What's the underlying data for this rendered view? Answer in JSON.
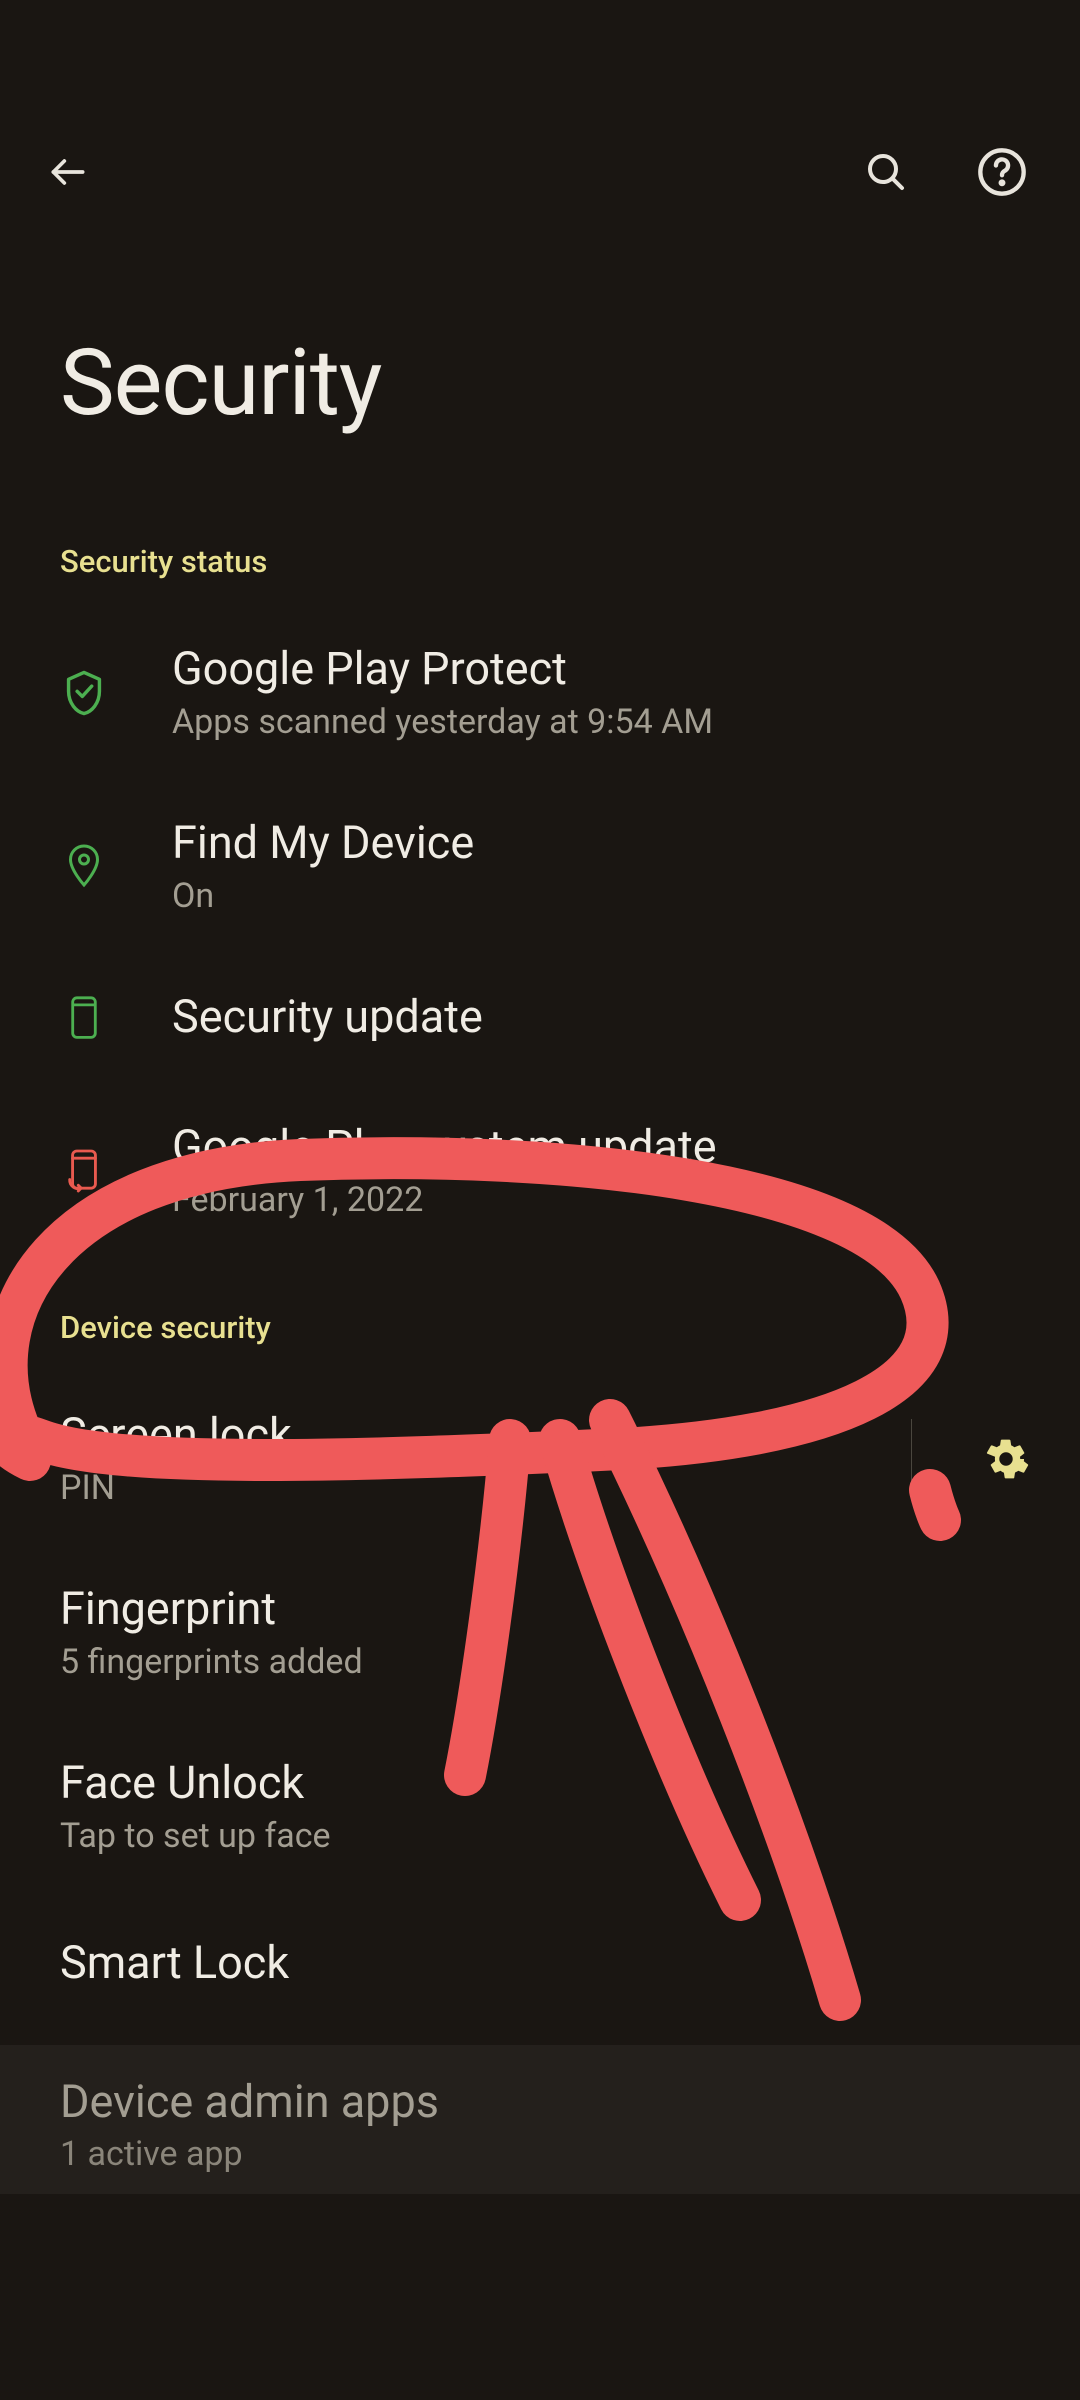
{
  "header": {
    "title": "Security"
  },
  "sections": {
    "status_label": "Security status",
    "device_label": "Device security"
  },
  "status": {
    "play_protect": {
      "title": "Google Play Protect",
      "sub": "Apps scanned yesterday at 9:54 AM"
    },
    "find_device": {
      "title": "Find My Device",
      "sub": "On"
    },
    "sec_update": {
      "title": "Security update"
    },
    "play_system": {
      "title": "Google Play system update",
      "sub": "February 1, 2022"
    }
  },
  "device": {
    "screen_lock": {
      "title": "Screen lock",
      "sub": "PIN"
    },
    "fingerprint": {
      "title": "Fingerprint",
      "sub": "5 fingerprints added"
    },
    "face_unlock": {
      "title": "Face Unlock",
      "sub": "Tap to set up face"
    },
    "smart_lock": {
      "title": "Smart Lock"
    }
  },
  "admin": {
    "title": "Device admin apps",
    "sub": "1 active app"
  },
  "colors": {
    "accent": "#e8e090",
    "icon_green": "#4caf50",
    "icon_warn": "#e85a4f",
    "annotation": "#ef5a5a"
  }
}
